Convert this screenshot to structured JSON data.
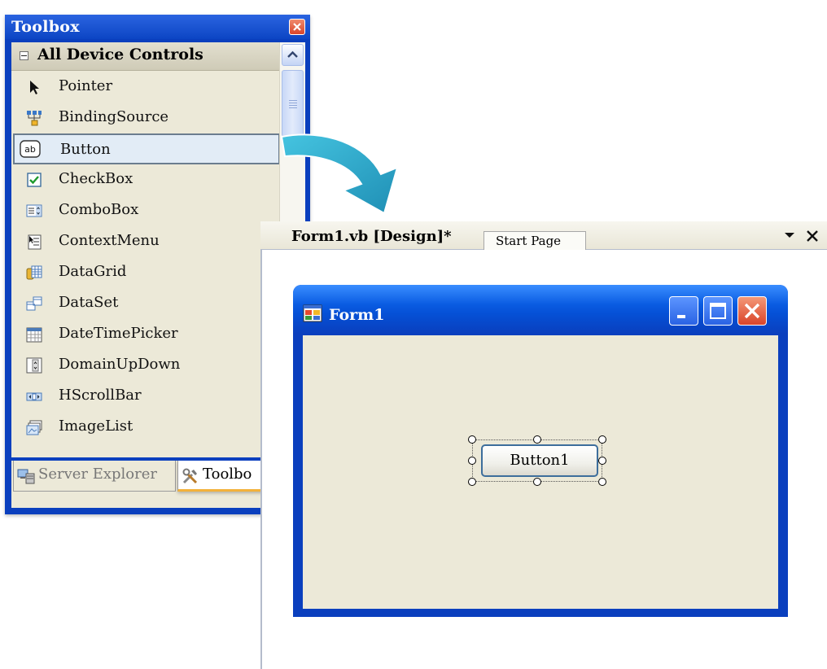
{
  "toolbox": {
    "title": "Toolbox",
    "section_header": "All Device Controls",
    "items": [
      {
        "label": "Pointer",
        "icon": "pointer-icon"
      },
      {
        "label": "BindingSource",
        "icon": "binding-source-icon"
      },
      {
        "label": "Button",
        "icon": "button-icon"
      },
      {
        "label": "CheckBox",
        "icon": "checkbox-icon"
      },
      {
        "label": "ComboBox",
        "icon": "combobox-icon"
      },
      {
        "label": "ContextMenu",
        "icon": "context-menu-icon"
      },
      {
        "label": "DataGrid",
        "icon": "datagrid-icon"
      },
      {
        "label": "DataSet",
        "icon": "dataset-icon"
      },
      {
        "label": "DateTimePicker",
        "icon": "datetimepicker-icon"
      },
      {
        "label": "DomainUpDown",
        "icon": "domainupdown-icon"
      },
      {
        "label": "HScrollBar",
        "icon": "hscrollbar-icon"
      },
      {
        "label": "ImageList",
        "icon": "imagelist-icon"
      }
    ],
    "selected_item": "Button",
    "bottom_tabs": [
      {
        "label": "Server Explorer",
        "icon": "server-explorer-icon"
      },
      {
        "label": "Toolbo",
        "icon": "toolbox-tools-icon"
      }
    ]
  },
  "designer": {
    "tabs": [
      {
        "label": "Form1.vb [Design]*",
        "active": true
      },
      {
        "label": "Start Page",
        "active": false
      }
    ],
    "form": {
      "title": "Form1",
      "button_label": "Button1"
    }
  },
  "colors": {
    "xp_blue": "#0a3fbe",
    "panel_bg": "#ece9d8",
    "arrow_teal": "#2aa6c8",
    "close_red": "#d9442a"
  }
}
